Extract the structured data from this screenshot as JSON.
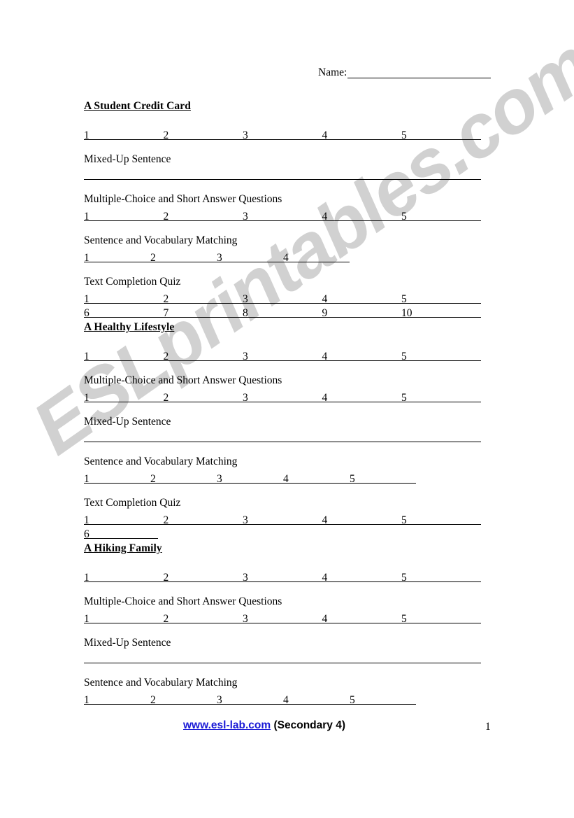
{
  "document": {
    "name_label": "Name:",
    "watermark": "ESLprintables.com"
  },
  "footer": {
    "link_text": "www.esl-lab.com",
    "suffix": " (Secondary 4)",
    "page_number": "1",
    "link_color": "#1a1ad6"
  },
  "sections": [
    {
      "title": "A Student Credit Card",
      "blocks": [
        {
          "label": "",
          "rows": [
            {
              "style": "wide",
              "numbers": [
                "1",
                "2",
                "3",
                "4",
                "5"
              ]
            }
          ]
        },
        {
          "label": "Mixed-Up Sentence",
          "rows": [
            {
              "style": "plain",
              "numbers": []
            }
          ]
        },
        {
          "label": "Multiple-Choice and Short Answer Questions",
          "rows": [
            {
              "style": "wide",
              "numbers": [
                "1",
                "2",
                "3",
                "4",
                "5"
              ]
            }
          ]
        },
        {
          "label": "Sentence and Vocabulary Matching",
          "rows": [
            {
              "style": "narrow",
              "numbers": [
                "1",
                "2",
                "3",
                "4"
              ]
            }
          ]
        },
        {
          "label": "Text Completion Quiz",
          "rows": [
            {
              "style": "wide",
              "numbers": [
                "1",
                "2",
                "3",
                "4",
                "5"
              ]
            },
            {
              "style": "wide",
              "numbers": [
                "6",
                "7",
                "8",
                "9",
                "10"
              ]
            }
          ]
        }
      ]
    },
    {
      "title": "A Healthy Lifestyle",
      "blocks": [
        {
          "label": "",
          "rows": [
            {
              "style": "wide",
              "numbers": [
                "1",
                "2",
                "3",
                "4",
                "5"
              ]
            }
          ]
        },
        {
          "label": "Multiple-Choice and Short Answer Questions",
          "rows": [
            {
              "style": "wide",
              "numbers": [
                "1",
                "2",
                "3",
                "4",
                "5"
              ]
            }
          ]
        },
        {
          "label": "Mixed-Up Sentence",
          "rows": [
            {
              "style": "plain",
              "numbers": []
            }
          ]
        },
        {
          "label": "Sentence and Vocabulary Matching",
          "rows": [
            {
              "style": "narrow",
              "numbers": [
                "1",
                "2",
                "3",
                "4",
                "5"
              ]
            }
          ]
        },
        {
          "label": "Text Completion Quiz",
          "rows": [
            {
              "style": "wide",
              "numbers": [
                "1",
                "2",
                "3",
                "4",
                "5"
              ]
            },
            {
              "style": "short",
              "numbers": [
                "6"
              ]
            }
          ]
        }
      ]
    },
    {
      "title": "A Hiking Family",
      "blocks": [
        {
          "label": "",
          "rows": [
            {
              "style": "wide",
              "numbers": [
                "1",
                "2",
                "3",
                "4",
                "5"
              ]
            }
          ]
        },
        {
          "label": "Multiple-Choice and Short Answer Questions",
          "rows": [
            {
              "style": "wide",
              "numbers": [
                "1",
                "2",
                "3",
                "4",
                "5"
              ]
            }
          ]
        },
        {
          "label": "Mixed-Up Sentence",
          "rows": [
            {
              "style": "plain",
              "numbers": []
            }
          ]
        },
        {
          "label": "Sentence and Vocabulary Matching",
          "rows": [
            {
              "style": "narrow",
              "numbers": [
                "1",
                "2",
                "3",
                "4",
                "5"
              ]
            }
          ]
        }
      ]
    }
  ],
  "layout": {
    "section_tops": [
      143,
      459,
      775
    ],
    "block_gaps": [
      34,
      22,
      22,
      22,
      22
    ]
  }
}
